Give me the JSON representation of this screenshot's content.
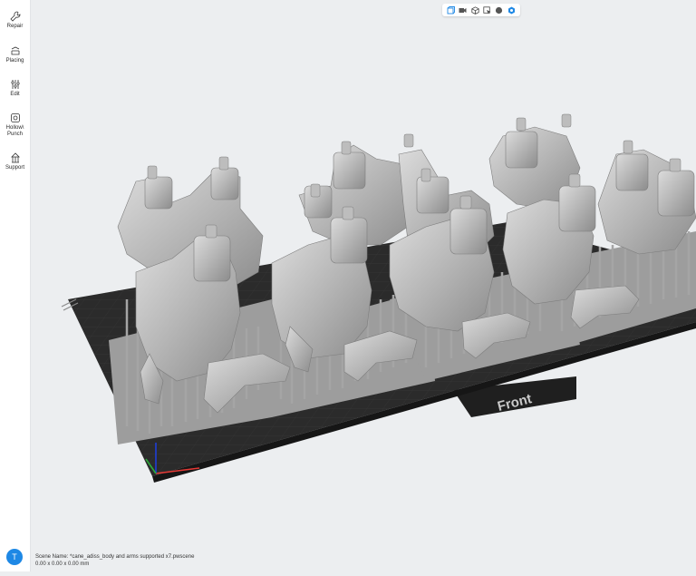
{
  "sidebar": {
    "items": [
      {
        "label": "Repair",
        "icon": "wrench-icon"
      },
      {
        "label": "Placing",
        "icon": "placing-icon"
      },
      {
        "label": "Edit",
        "icon": "sliders-icon"
      },
      {
        "label": "Hollow\\\nPunch",
        "icon": "hollow-icon"
      },
      {
        "label": "Support",
        "icon": "support-icon"
      }
    ],
    "user_initial": "T"
  },
  "toolbar": {
    "buttons": [
      "cube-view-icon",
      "camera-icon",
      "perspective-icon",
      "select-icon",
      "sphere-icon",
      "settings-icon"
    ]
  },
  "viewport": {
    "plate_label": "Front"
  },
  "status": {
    "scene_name": "Scene Name: *cane_adiss_body and arms supported x7.pwscene",
    "dimensions": "0.00 x 0.00 x 0.00 mm"
  },
  "colors": {
    "accent": "#1e88e5",
    "plate": "#2b2b2b",
    "model": "#b9b9b9"
  }
}
